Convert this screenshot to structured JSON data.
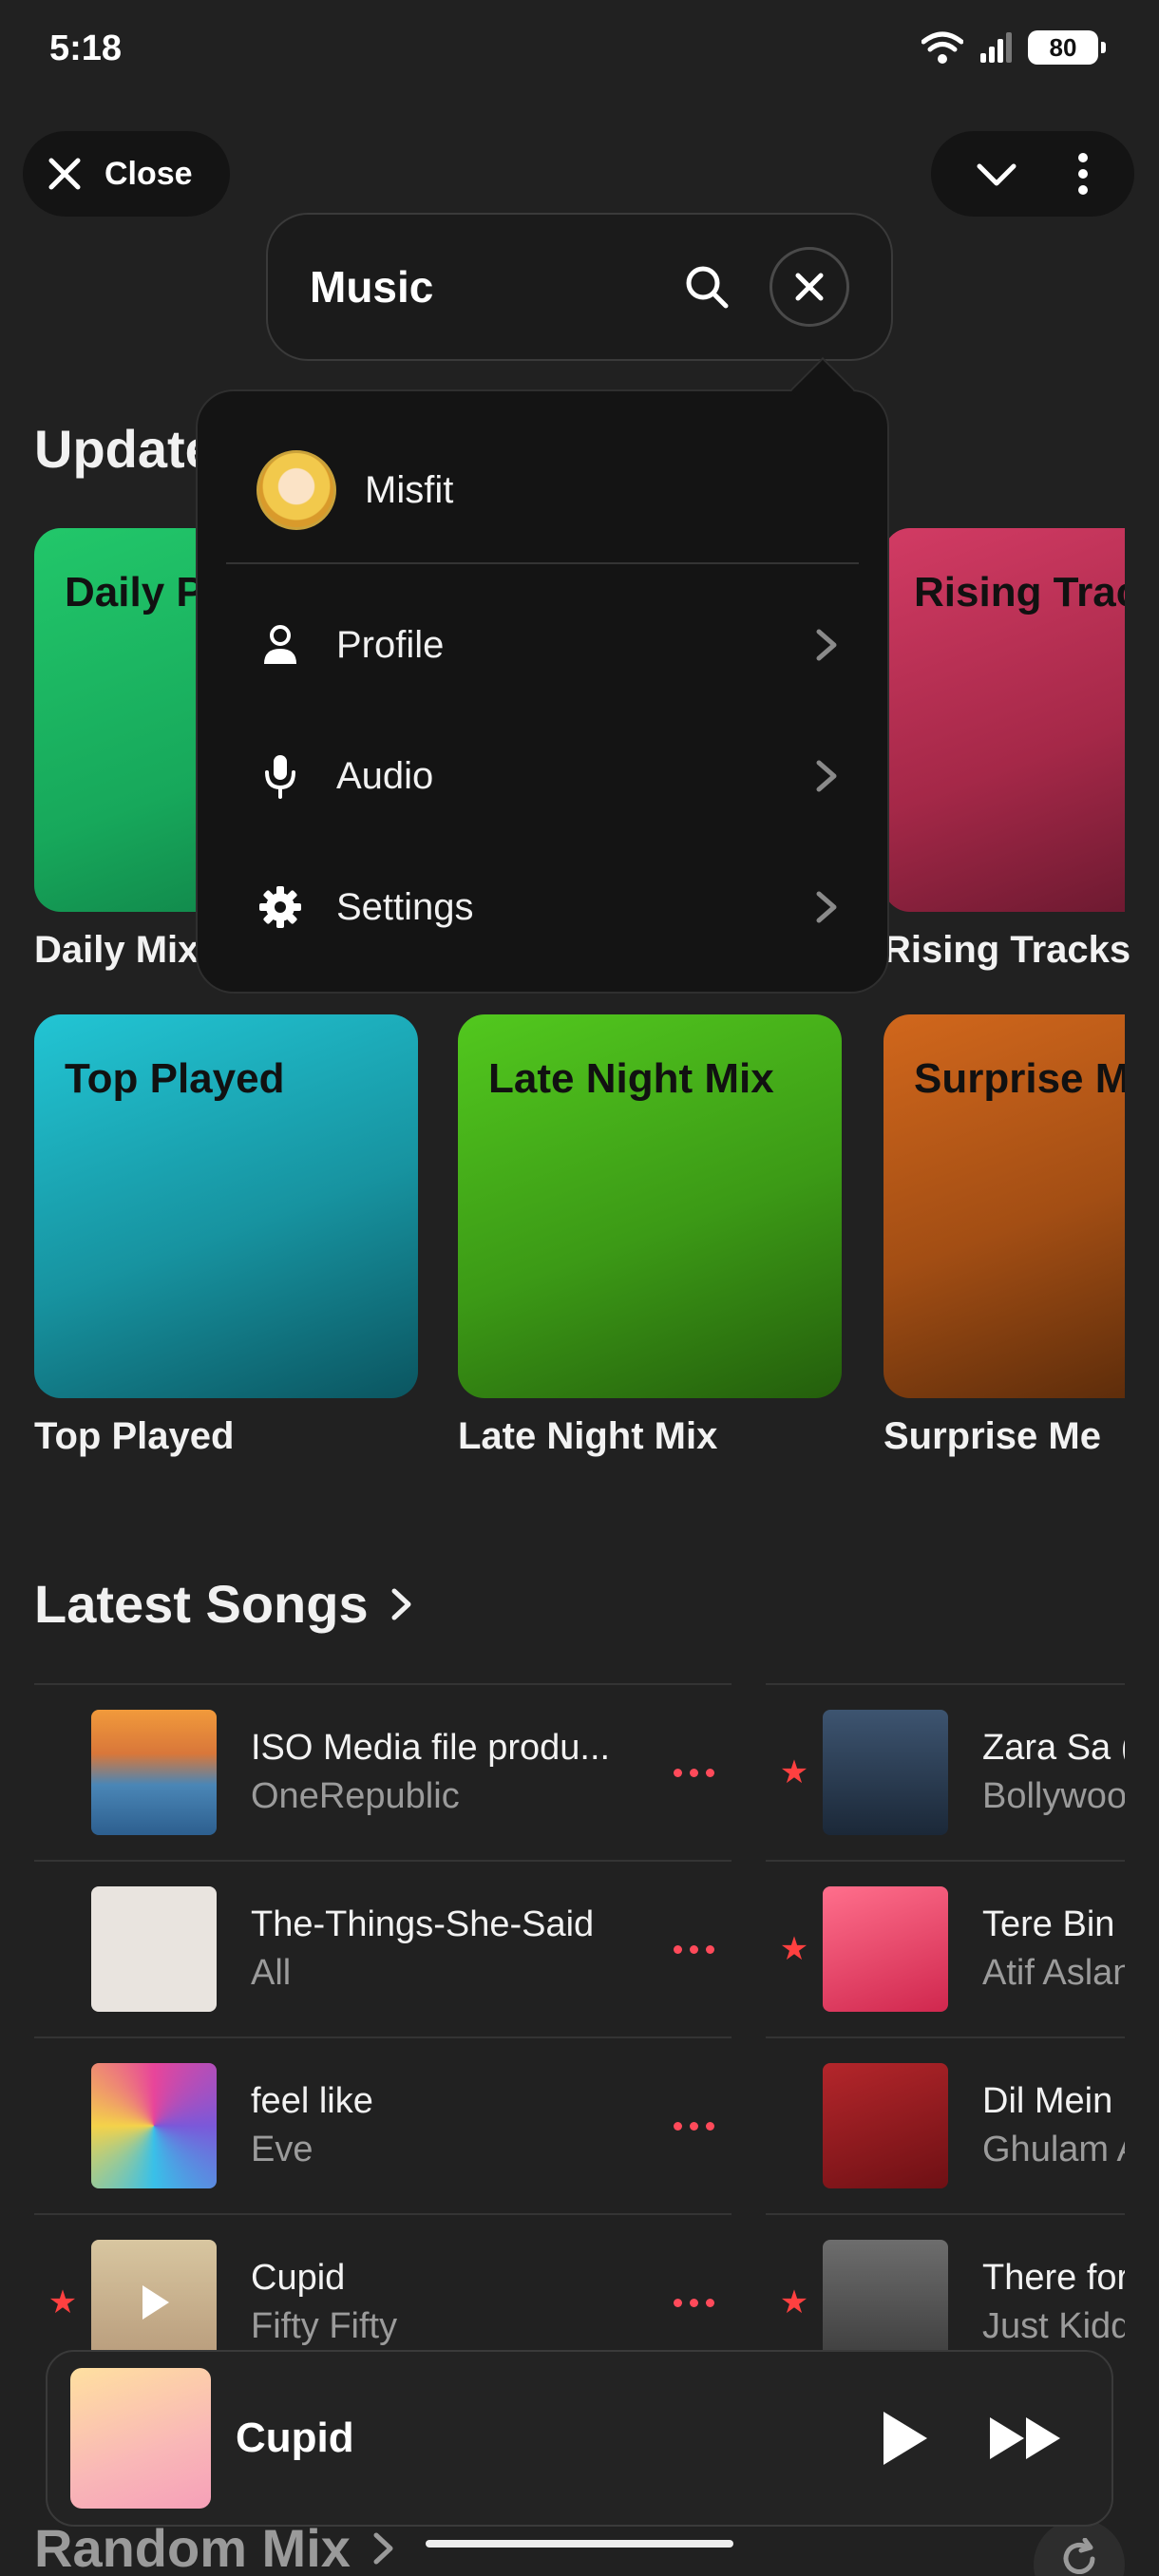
{
  "status": {
    "time": "5:18",
    "battery": "80"
  },
  "top": {
    "close_label": "Close"
  },
  "search": {
    "query": "Music"
  },
  "sections": {
    "updated": "Updated",
    "latest": "Latest Songs",
    "random": "Random Mix"
  },
  "tiles": [
    {
      "name": "Daily Playlist",
      "caption": "Daily Mix"
    },
    {
      "name": "Rising Tracks",
      "caption": "Rising Tracks"
    },
    {
      "name": "Top Played",
      "caption": "Top Played"
    },
    {
      "name": "Late Night Mix",
      "caption": "Late Night Mix"
    },
    {
      "name": "Surprise Me",
      "caption": "Surprise Me"
    }
  ],
  "menu": {
    "user": "Misfit",
    "items": [
      {
        "label": "Profile",
        "icon": "person-icon"
      },
      {
        "label": "Audio",
        "icon": "microphone-icon"
      },
      {
        "label": "Settings",
        "icon": "gear-icon"
      }
    ]
  },
  "songs_left": [
    {
      "title": "ISO Media file produ...",
      "artist": "OneRepublic",
      "starred": false
    },
    {
      "title": "The-Things-She-Said",
      "artist": "All",
      "starred": false
    },
    {
      "title": "feel like",
      "artist": "Eve",
      "starred": false
    },
    {
      "title": "Cupid",
      "artist": "Fifty Fifty",
      "starred": true
    }
  ],
  "songs_right": [
    {
      "title": "Zara Sa (",
      "artist": "Bollywoo",
      "starred": true
    },
    {
      "title": "Tere Bin",
      "artist": "Atif Aslan",
      "starred": true
    },
    {
      "title": "Dil Mein E",
      "artist": "Ghulam A",
      "starred": false
    },
    {
      "title": "There for",
      "artist": "Just Kidd",
      "starred": true
    }
  ],
  "player": {
    "title": "Cupid"
  },
  "colors": {
    "accent": "#ff4a5a",
    "star": "#ff4040",
    "background": "#212121"
  }
}
